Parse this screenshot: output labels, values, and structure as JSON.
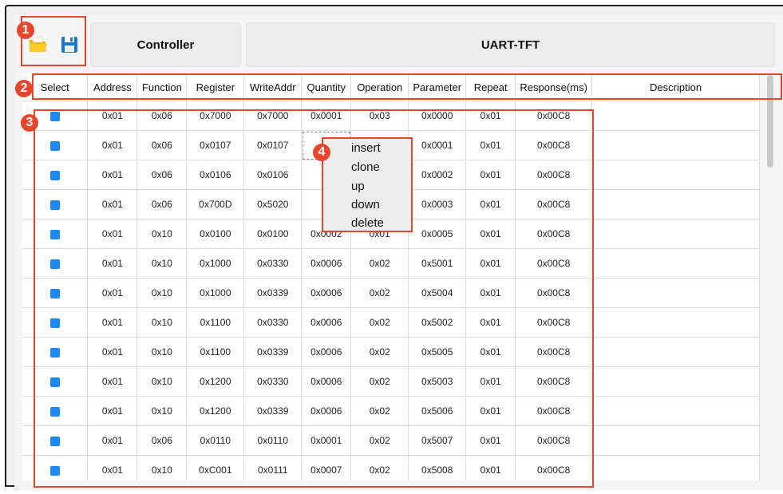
{
  "toolbar": {
    "open_icon": "folder-open-icon",
    "save_icon": "floppy-save-icon",
    "tabs": [
      {
        "label": "Controller"
      },
      {
        "label": "UART-TFT"
      }
    ]
  },
  "table": {
    "columns": [
      "Select",
      "Address",
      "Function",
      "Register",
      "WriteAddr",
      "Quantity",
      "Operation",
      "Parameter",
      "Repeat",
      "Response(ms)",
      "Description"
    ],
    "rows": [
      {
        "address": "0x01",
        "function": "0x06",
        "register": "0x7000",
        "write_addr": "0x7000",
        "quantity": "0x0001",
        "operation": "0x03",
        "parameter": "0x0000",
        "repeat": "0x01",
        "response": "0x00C8",
        "description": ""
      },
      {
        "address": "0x01",
        "function": "0x06",
        "register": "0x0107",
        "write_addr": "0x0107",
        "quantity": "0",
        "operation": "",
        "parameter": "0x0001",
        "repeat": "0x01",
        "response": "0x00C8",
        "description": ""
      },
      {
        "address": "0x01",
        "function": "0x06",
        "register": "0x0106",
        "write_addr": "0x0106",
        "quantity": "0x",
        "operation": "",
        "parameter": "0x0002",
        "repeat": "0x01",
        "response": "0x00C8",
        "description": ""
      },
      {
        "address": "0x01",
        "function": "0x06",
        "register": "0x700D",
        "write_addr": "0x5020",
        "quantity": "0x",
        "operation": "",
        "parameter": "0x0003",
        "repeat": "0x01",
        "response": "0x00C8",
        "description": ""
      },
      {
        "address": "0x01",
        "function": "0x10",
        "register": "0x0100",
        "write_addr": "0x0100",
        "quantity": "0x0002",
        "operation": "0x01",
        "parameter": "0x0005",
        "repeat": "0x01",
        "response": "0x00C8",
        "description": ""
      },
      {
        "address": "0x01",
        "function": "0x10",
        "register": "0x1000",
        "write_addr": "0x0330",
        "quantity": "0x0006",
        "operation": "0x02",
        "parameter": "0x5001",
        "repeat": "0x01",
        "response": "0x00C8",
        "description": ""
      },
      {
        "address": "0x01",
        "function": "0x10",
        "register": "0x1000",
        "write_addr": "0x0339",
        "quantity": "0x0006",
        "operation": "0x02",
        "parameter": "0x5004",
        "repeat": "0x01",
        "response": "0x00C8",
        "description": ""
      },
      {
        "address": "0x01",
        "function": "0x10",
        "register": "0x1100",
        "write_addr": "0x0330",
        "quantity": "0x0006",
        "operation": "0x02",
        "parameter": "0x5002",
        "repeat": "0x01",
        "response": "0x00C8",
        "description": ""
      },
      {
        "address": "0x01",
        "function": "0x10",
        "register": "0x1100",
        "write_addr": "0x0339",
        "quantity": "0x0006",
        "operation": "0x02",
        "parameter": "0x5005",
        "repeat": "0x01",
        "response": "0x00C8",
        "description": ""
      },
      {
        "address": "0x01",
        "function": "0x10",
        "register": "0x1200",
        "write_addr": "0x0330",
        "quantity": "0x0006",
        "operation": "0x02",
        "parameter": "0x5003",
        "repeat": "0x01",
        "response": "0x00C8",
        "description": ""
      },
      {
        "address": "0x01",
        "function": "0x10",
        "register": "0x1200",
        "write_addr": "0x0339",
        "quantity": "0x0006",
        "operation": "0x02",
        "parameter": "0x5006",
        "repeat": "0x01",
        "response": "0x00C8",
        "description": ""
      },
      {
        "address": "0x01",
        "function": "0x06",
        "register": "0x0110",
        "write_addr": "0x0110",
        "quantity": "0x0001",
        "operation": "0x02",
        "parameter": "0x5007",
        "repeat": "0x01",
        "response": "0x00C8",
        "description": ""
      },
      {
        "address": "0x01",
        "function": "0x10",
        "register": "0xC001",
        "write_addr": "0x0111",
        "quantity": "0x0007",
        "operation": "0x02",
        "parameter": "0x5008",
        "repeat": "0x01",
        "response": "0x00C8",
        "description": ""
      }
    ]
  },
  "context_menu": {
    "items": [
      "insert",
      "clone",
      "up",
      "down",
      "delete"
    ]
  },
  "annotations": [
    "1",
    "2",
    "3",
    "4"
  ],
  "colors": {
    "accent_checkbox": "#1e88f2",
    "annotation_red": "#e8452a",
    "save_icon_blue": "#1976d2",
    "folder_yellow": "#f4b400"
  }
}
